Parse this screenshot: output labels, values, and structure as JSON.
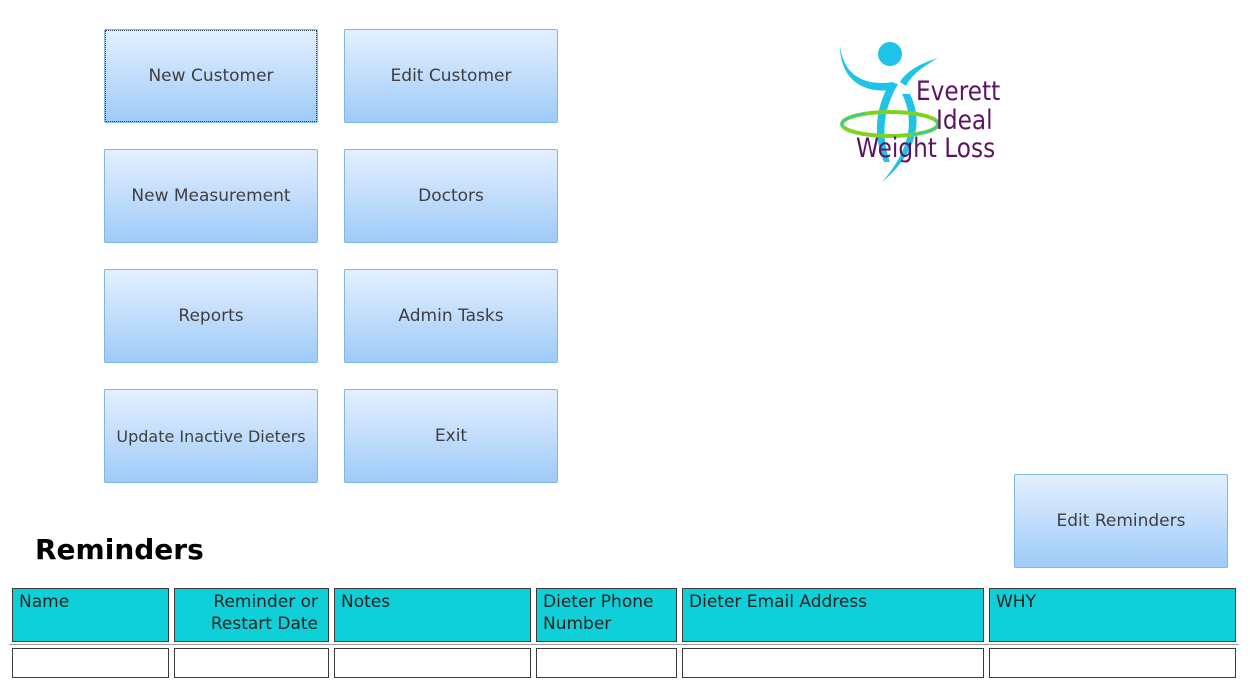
{
  "nav": {
    "new_customer": "New Customer",
    "edit_customer": "Edit Customer",
    "new_measurement": "New Measurement",
    "doctors": "Doctors",
    "reports": "Reports",
    "admin_tasks": "Admin Tasks",
    "update_inactive": "Update Inactive Dieters",
    "exit": "Exit"
  },
  "logo": {
    "line1": "Everett",
    "line2": "Ideal",
    "line3": "Weight Loss",
    "colors": {
      "figure": "#1fc3e8",
      "ring": "#7ed321",
      "text": "#5c1563"
    }
  },
  "reminders": {
    "title": "Reminders",
    "edit_button": "Edit Reminders",
    "columns": [
      "Name",
      "Reminder or Restart Date",
      "Notes",
      "Dieter Phone Number",
      "Dieter Email Address",
      "WHY"
    ],
    "rows": [
      [
        "",
        "",
        "",
        "",
        "",
        ""
      ]
    ],
    "header_color": "#0fd0d8"
  }
}
